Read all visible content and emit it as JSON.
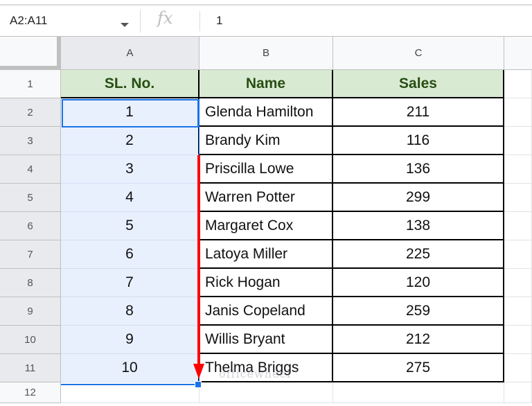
{
  "formula_bar": {
    "name_box": "A2:A11",
    "fx_label": "fx",
    "formula_value": "1"
  },
  "columns": [
    "A",
    "B",
    "C"
  ],
  "row_numbers": [
    "1",
    "2",
    "3",
    "4",
    "5",
    "6",
    "7",
    "8",
    "9",
    "10",
    "11",
    "12"
  ],
  "table": {
    "headers": [
      "SL. No.",
      "Name",
      "Sales"
    ],
    "rows": [
      {
        "sl": "1",
        "name": "Glenda Hamilton",
        "sales": "211"
      },
      {
        "sl": "2",
        "name": "Brandy Kim",
        "sales": "116"
      },
      {
        "sl": "3",
        "name": "Priscilla Lowe",
        "sales": "136"
      },
      {
        "sl": "4",
        "name": "Warren Potter",
        "sales": "299"
      },
      {
        "sl": "5",
        "name": "Margaret Cox",
        "sales": "138"
      },
      {
        "sl": "6",
        "name": "Latoya Miller",
        "sales": "225"
      },
      {
        "sl": "7",
        "name": "Rick Hogan",
        "sales": "120"
      },
      {
        "sl": "8",
        "name": "Janis Copeland",
        "sales": "259"
      },
      {
        "sl": "9",
        "name": "Willis Bryant",
        "sales": "212"
      },
      {
        "sl": "10",
        "name": "Thelma Briggs",
        "sales": "275"
      }
    ]
  },
  "watermark": "officewheel",
  "colors": {
    "header_fill": "#d9ead3",
    "header_text": "#274e13",
    "selection_fill": "#e8f0fe",
    "selection_border": "#1a73e8",
    "annotation_arrow": "#ff0000"
  }
}
